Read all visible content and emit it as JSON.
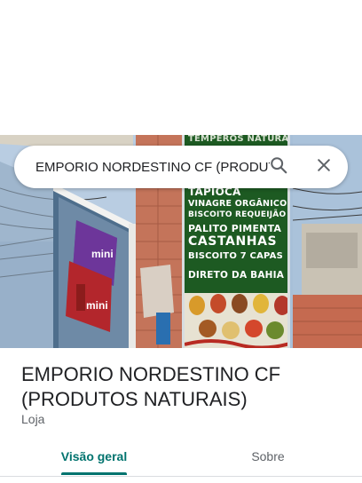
{
  "search": {
    "query": "EMPORIO NORDESTINO CF (PRODUTOS NATURAIS)"
  },
  "photo": {
    "sign_lines": [
      "TEMPEROS NATURAIS",
      "TAPIOCA",
      "VINAGRE ORGÂNICO",
      "BISCOITO REQUEIJÃO",
      "PALITO PIMENTA",
      "CASTANHAS",
      "BISCOITO 7 CAPAS",
      "DIRETO DA BAHIA"
    ],
    "poster_text_top": "mini",
    "poster_text_bottom": "mini"
  },
  "place": {
    "name": "EMPORIO NORDESTINO CF (PRODUTOS NATURAIS)",
    "category": "Loja"
  },
  "tabs": {
    "overview": "Visão geral",
    "about": "Sobre"
  },
  "colors": {
    "accent": "#00736e",
    "sign_green": "#1d5a22"
  },
  "icons": {
    "search": "search-icon",
    "close": "close-icon"
  }
}
